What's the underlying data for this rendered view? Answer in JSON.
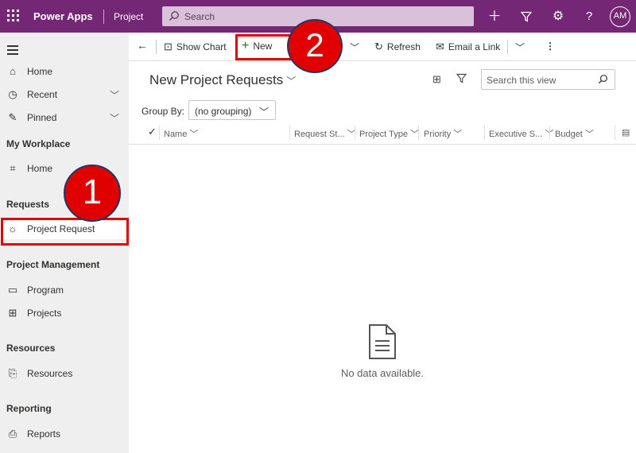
{
  "topbar": {
    "app_name": "Power Apps",
    "area": "Project",
    "search_placeholder": "Search",
    "avatar_initials": "AM",
    "icons": [
      "waffle-icon",
      "add-icon",
      "filter-icon",
      "settings-icon",
      "help-icon"
    ]
  },
  "sidebar": {
    "home": "Home",
    "recent": "Recent",
    "pinned": "Pinned",
    "my_workplace": "My Workplace",
    "workplace_home": "Home",
    "requests_section": "Requests",
    "project_request": "Project Request",
    "pm_section": "Project Management",
    "program": "Program",
    "projects": "Projects",
    "resources_section": "Resources",
    "resources": "Resources",
    "reporting_section": "Reporting",
    "reports": "Reports"
  },
  "commandbar": {
    "show_chart": "Show Chart",
    "new": "New",
    "refresh": "Refresh",
    "email_link": "Email a Link"
  },
  "view": {
    "title": "New Project Requests",
    "search_placeholder": "Search this view",
    "group_by_label": "Group By:",
    "group_by_value": "(no grouping)"
  },
  "columns": [
    "Name",
    "Request St...",
    "Project Type",
    "Priority",
    "Executive S...",
    "Budget"
  ],
  "empty_text": "No data available.",
  "callouts": {
    "one": "1",
    "two": "2"
  },
  "colors": {
    "header": "#742774",
    "callout": "#e00000",
    "new_icon": "#107c10"
  }
}
